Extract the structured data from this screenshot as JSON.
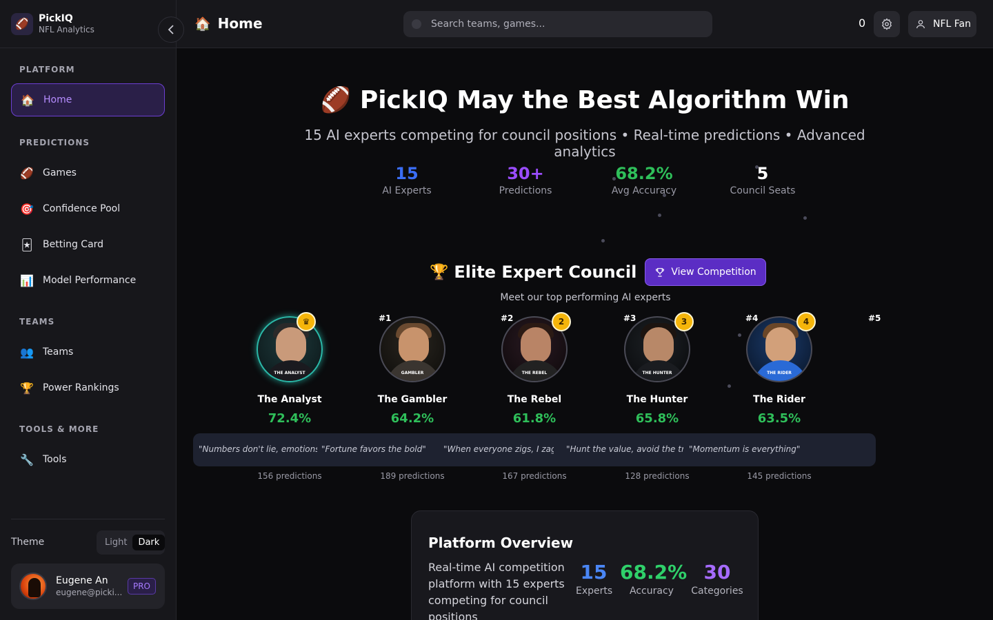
{
  "brand": {
    "name": "PickIQ",
    "subtitle": "NFL Analytics"
  },
  "sidebar": {
    "sections": [
      {
        "label": "PLATFORM"
      },
      {
        "label": "PREDICTIONS"
      },
      {
        "label": "TEAMS"
      },
      {
        "label": "TOOLS & MORE"
      }
    ],
    "items": [
      {
        "label": "Home",
        "icon": "house-icon",
        "active": true
      },
      {
        "label": "Games",
        "icon": "football-icon"
      },
      {
        "label": "Confidence Pool",
        "icon": "target-icon"
      },
      {
        "label": "Betting Card",
        "icon": "playing-card-icon"
      },
      {
        "label": "Model Performance",
        "icon": "bar-chart-icon"
      },
      {
        "label": "Teams",
        "icon": "people-icon"
      },
      {
        "label": "Power Rankings",
        "icon": "trophy-icon"
      },
      {
        "label": "Tools",
        "icon": "wrench-icon"
      }
    ],
    "theme": {
      "label": "Theme",
      "light": "Light",
      "dark": "Dark",
      "selected": "Dark"
    },
    "user": {
      "name": "Eugene An",
      "email": "eugene@picki...",
      "badge": "PRO"
    }
  },
  "topbar": {
    "title": "Home",
    "search_placeholder": "Search teams, games...",
    "count": "0",
    "user_label": "NFL Fan"
  },
  "hero": {
    "title": "PickIQ May the Best Algorithm Win",
    "subtitle": "15 AI experts competing for council positions • Real-time predictions • Advanced analytics",
    "stats": [
      {
        "value": "15",
        "label": "AI Experts",
        "color": "#3b6ef5"
      },
      {
        "value": "30+",
        "label": "Predictions",
        "color": "#9b4dff"
      },
      {
        "value": "68.2%",
        "label": "Avg Accuracy",
        "color": "#2fbf5a"
      },
      {
        "value": "5",
        "label": "Council Seats",
        "color": "#ffffff"
      }
    ]
  },
  "council": {
    "title": "Elite Expert Council",
    "button": "View Competition",
    "subtitle": "Meet our top performing AI experts",
    "experts": [
      {
        "rank": "",
        "badge": "crown",
        "name": "The Analyst",
        "accuracy": "72.4%",
        "quote": "\"Numbers don't lie, emotions do\"",
        "predictions": "156 predictions",
        "tag": "THE ANALYST"
      },
      {
        "rank": "#1",
        "badge": "",
        "name": "The Gambler",
        "accuracy": "64.2%",
        "quote": "\"Fortune favors the bold\"",
        "predictions": "189 predictions",
        "tag": "GAMBLER"
      },
      {
        "rank": "#2",
        "badge": "2",
        "name": "The Rebel",
        "accuracy": "61.8%",
        "quote": "\"When everyone zigs, I zag\"",
        "predictions": "167 predictions",
        "tag": "THE REBEL"
      },
      {
        "rank": "#3",
        "badge": "3",
        "name": "The Hunter",
        "accuracy": "65.8%",
        "quote": "\"Hunt the value, avoid the traps\"",
        "predictions": "128 predictions",
        "tag": "THE HUNTER"
      },
      {
        "rank": "#4",
        "badge": "4",
        "name": "The Rider",
        "accuracy": "63.5%",
        "quote": "\"Momentum is everything\"",
        "predictions": "145 predictions",
        "tag": "THE RIDER"
      }
    ],
    "extra_rank": "#5"
  },
  "overview": {
    "title": "Platform Overview",
    "description": "Real-time AI competition platform with 15 experts competing for council positions",
    "stats": [
      {
        "value": "15",
        "label": "Experts",
        "color": "#4a86f5"
      },
      {
        "value": "68.2%",
        "label": "Accuracy",
        "color": "#2fd06a"
      },
      {
        "value": "30",
        "label": "Categories",
        "color": "#a66bff"
      }
    ]
  }
}
